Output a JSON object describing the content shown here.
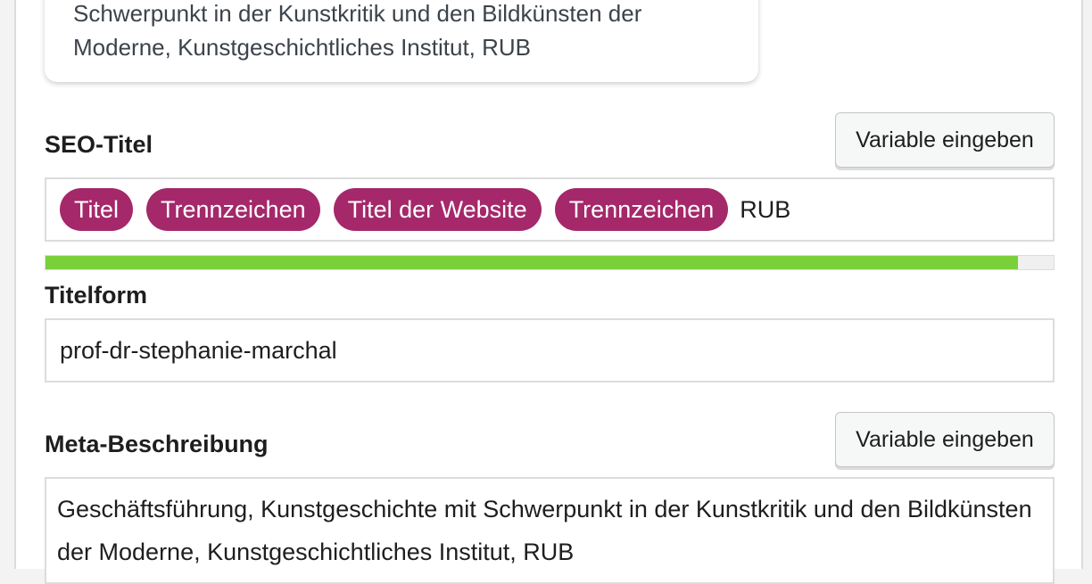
{
  "preview": {
    "description": "Schwerpunkt in der Kunstkritik und den Bildkünsten der Moderne, Kunstgeschichtliches Institut, RUB"
  },
  "seo_title": {
    "label": "SEO-Titel",
    "button_label": "Variable eingeben",
    "variables": [
      "Titel",
      "Trennzeichen",
      "Titel der Website",
      "Trennzeichen"
    ],
    "suffix": "RUB",
    "progress_percent": 96.5
  },
  "slug": {
    "label": "Titelform",
    "value": "prof-dr-stephanie-marchal"
  },
  "meta_description": {
    "label": "Meta-Beschreibung",
    "button_label": "Variable eingeben",
    "value": "Geschäftsführung, Kunstgeschichte mit Schwerpunkt in der Kunstkritik und den Bildkünsten der Moderne, Kunstgeschichtliches Institut, RUB"
  },
  "colors": {
    "variable_pill": "#a4286a",
    "progress_good": "#7ad03a"
  }
}
